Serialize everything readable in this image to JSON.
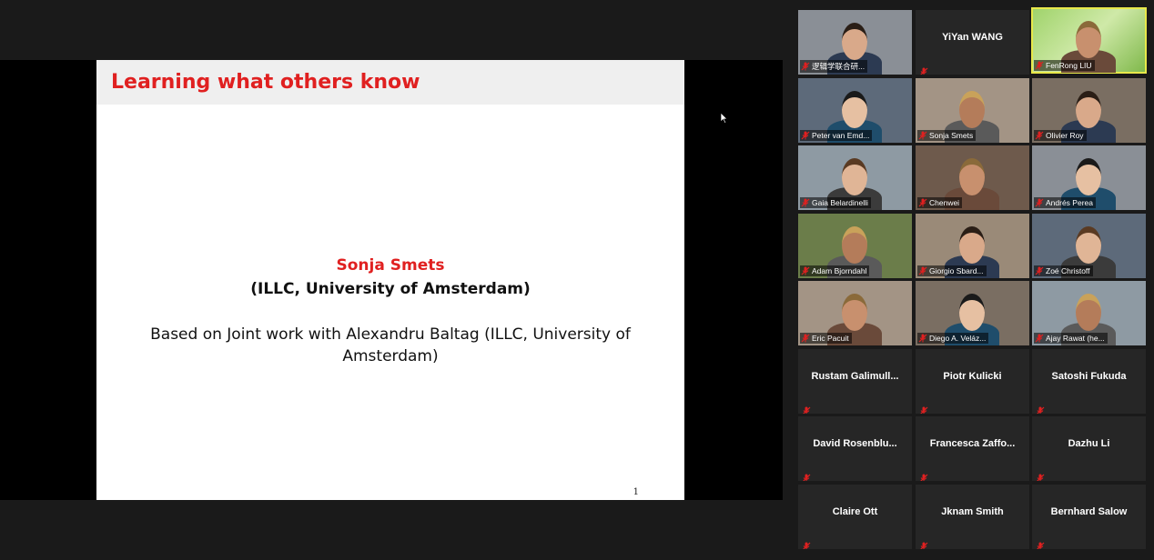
{
  "slide": {
    "title": "Learning what others know",
    "presenter": "Sonja Smets",
    "affiliation": "(ILLC, University of Amsterdam)",
    "joint_work": "Based on Joint work with Alexandru Baltag (ILLC, University of Amsterdam)",
    "page": "1"
  },
  "participants": [
    {
      "name": "逻辑学联合研...",
      "video": true
    },
    {
      "name": "YiYan WANG",
      "video": false
    },
    {
      "name": "FenRong LIU",
      "video": true
    },
    {
      "name": "Peter van Emd...",
      "video": true
    },
    {
      "name": "Sonja Smets",
      "video": true
    },
    {
      "name": "Olivier Roy",
      "video": true
    },
    {
      "name": "Gaia Belardinelli",
      "video": true
    },
    {
      "name": "Chenwei",
      "video": true
    },
    {
      "name": "Andrés Perea",
      "video": true
    },
    {
      "name": "Adam Bjorndahl",
      "video": true
    },
    {
      "name": "Giorgio Sbard...",
      "video": true
    },
    {
      "name": "Zoé Christoff",
      "video": true
    },
    {
      "name": "Eric Pacuit",
      "video": true
    },
    {
      "name": "Diego A. Veláz...",
      "video": true
    },
    {
      "name": "Ajay Rawat (he...",
      "video": true
    },
    {
      "name": "Rustam  Galimull...",
      "video": false
    },
    {
      "name": "Piotr Kulicki",
      "video": false
    },
    {
      "name": "Satoshi Fukuda",
      "video": false
    },
    {
      "name": "David  Rosenblu...",
      "video": false
    },
    {
      "name": "Francesca  Zaffo...",
      "video": false
    },
    {
      "name": "Dazhu Li",
      "video": false
    },
    {
      "name": "Claire Ott",
      "video": false
    },
    {
      "name": "Jknam Smith",
      "video": false
    },
    {
      "name": "Bernhard Salow",
      "video": false
    }
  ],
  "colors": {
    "slide_accent": "#e02020",
    "active_speaker": "#e8e84a",
    "muted_icon": "#e02020"
  }
}
